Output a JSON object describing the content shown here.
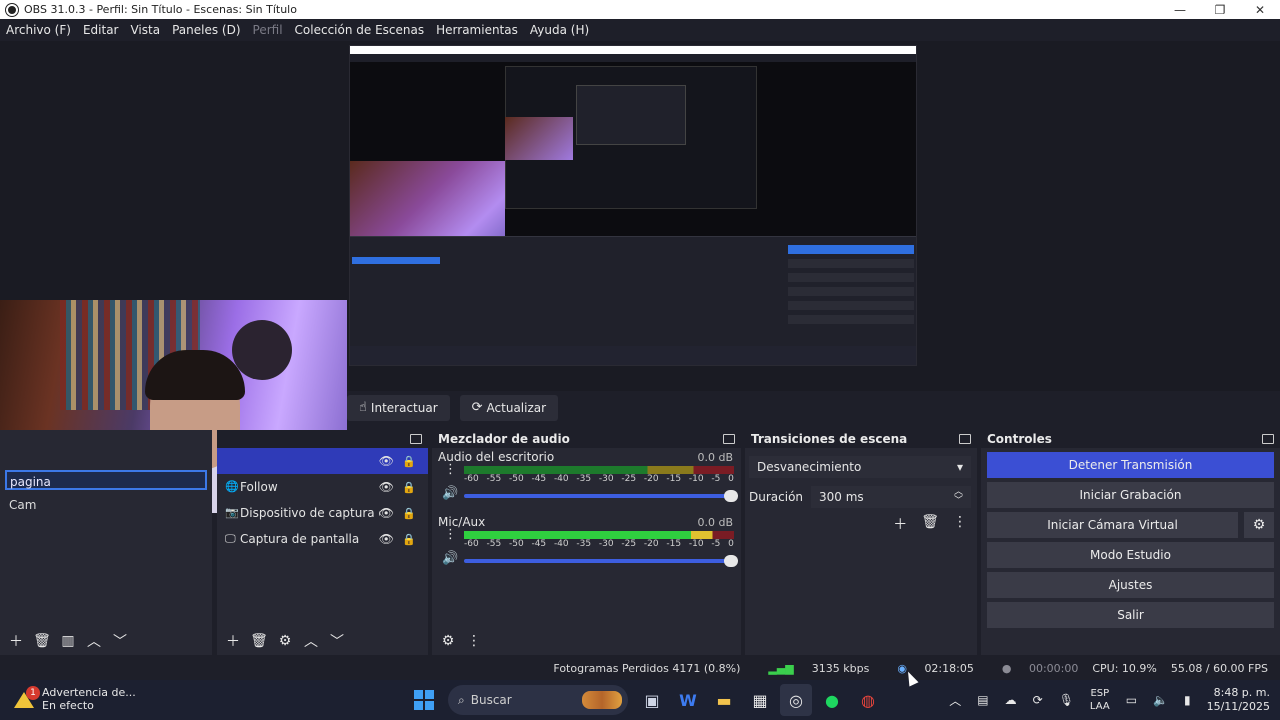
{
  "window": {
    "title": "OBS 31.0.3 - Perfil: Sin Título - Escenas: Sin Título",
    "minimize": "—",
    "restore": "❐",
    "close": "✕"
  },
  "menu": [
    "Archivo (F)",
    "Editar",
    "Vista",
    "Paneles (D)",
    "Perfil",
    "Colección de Escenas",
    "Herramientas",
    "Ayuda (H)"
  ],
  "toolbar": {
    "interact_label": "Interactuar",
    "refresh_label": "Actualizar"
  },
  "scenes": {
    "items": [
      "pagina",
      "Cam"
    ],
    "selected_index": 0
  },
  "sources": {
    "items": [
      {
        "name": "",
        "icon": "blank-icon"
      },
      {
        "name": "Follow",
        "icon": "globe-icon"
      },
      {
        "name": "Dispositivo de captura de video",
        "icon": "camera-icon"
      },
      {
        "name": "Captura de pantalla",
        "icon": "monitor-icon"
      }
    ]
  },
  "mixer": {
    "title": "Mezclador de audio",
    "channels": [
      {
        "name": "Audio del escritorio",
        "db": "0.0 dB",
        "level": 0
      },
      {
        "name": "Mic/Aux",
        "db": "0.0 dB",
        "level": 0.92
      }
    ],
    "scale": [
      "-60",
      "-55",
      "-50",
      "-45",
      "-40",
      "-35",
      "-30",
      "-25",
      "-20",
      "-15",
      "-10",
      "-5",
      "0"
    ]
  },
  "transitions": {
    "title": "Transiciones de escena",
    "selected": "Desvanecimiento",
    "duration_label": "Duración",
    "duration_value": "300 ms"
  },
  "controls": {
    "title": "Controles",
    "stop_stream": "Detener Transmisión",
    "start_record": "Iniciar Grabación",
    "start_virtual_cam": "Iniciar Cámara Virtual",
    "studio_mode": "Modo Estudio",
    "settings": "Ajustes",
    "exit": "Salir"
  },
  "status": {
    "dropped_frames": "Fotogramas Perdidos 4171 (0.8%)",
    "kbps": "3135 kbps",
    "stream_time": "02:18:05",
    "record_time": "00:00:00",
    "cpu": "CPU: 10.9%",
    "fps": "55.08 / 60.00 FPS"
  },
  "taskbar": {
    "notification_title": "Advertencia de...",
    "notification_sub": "En efecto",
    "notification_count": "1",
    "search_placeholder": "Buscar",
    "lang_top": "ESP",
    "lang_bottom": "LAA",
    "time": "8:48 p. m.",
    "date": "15/11/2025"
  },
  "colors": {
    "accent": "#3b4fd4",
    "dock_bg": "#272833",
    "meter_green": "#2fd03f"
  }
}
